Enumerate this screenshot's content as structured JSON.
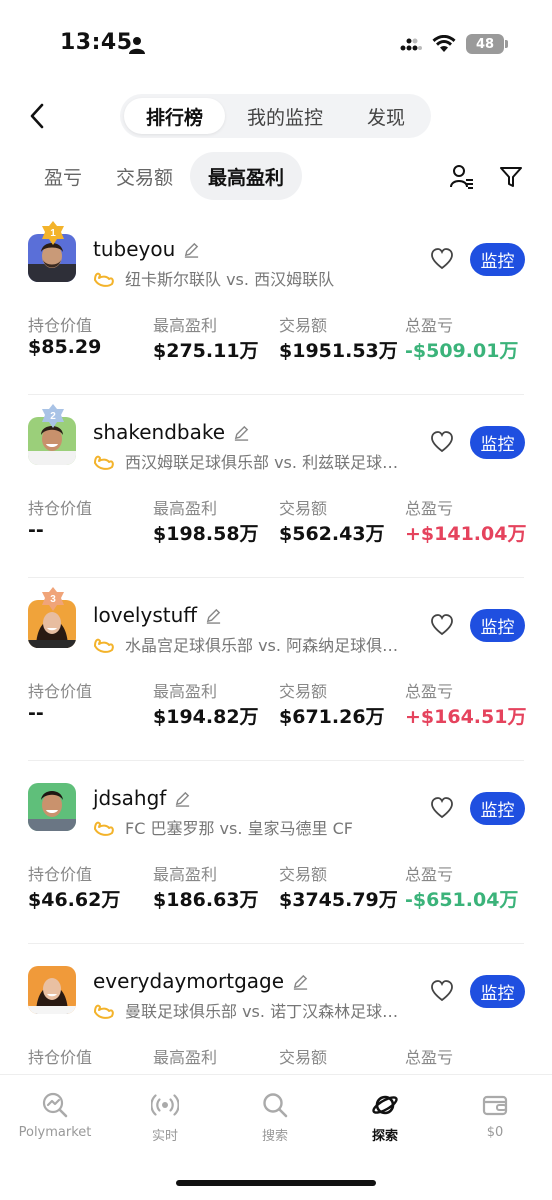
{
  "status_bar": {
    "time": "13:45",
    "battery": "48"
  },
  "nav": {
    "tabs": [
      {
        "label": "排行榜",
        "active": true
      },
      {
        "label": "我的监控",
        "active": false
      },
      {
        "label": "发现",
        "active": false
      }
    ]
  },
  "sub_tabs": [
    {
      "label": "盈亏",
      "active": false
    },
    {
      "label": "交易额",
      "active": false
    },
    {
      "label": "最高盈利",
      "active": true
    }
  ],
  "stat_labels": {
    "position": "持仓价值",
    "max_profit": "最高盈利",
    "volume": "交易额",
    "pnl": "总盈亏"
  },
  "monitor_label": "监控",
  "rank_badges": [
    "1",
    "2",
    "3"
  ],
  "colors": {
    "accent": "#1f4fe0",
    "profit": "#e5435d",
    "loss": "#3bb37a",
    "gold": "#f3b32b",
    "silver": "#a9c3e6",
    "bronze": "#f0a479"
  },
  "traders": [
    {
      "rank": "1",
      "name": "tubeyou",
      "match": "纽卡斯尔联队 vs. 西汉姆联队",
      "position": "$85.29",
      "max_profit": "$275.11万",
      "volume": "$1951.53万",
      "pnl": "-$509.01万",
      "pnl_sign": "neg"
    },
    {
      "rank": "2",
      "name": "shakendbake",
      "match": "西汉姆联足球俱乐部 vs. 利兹联足球俱乐部",
      "position": "--",
      "max_profit": "$198.58万",
      "volume": "$562.43万",
      "pnl": "+$141.04万",
      "pnl_sign": "pos"
    },
    {
      "rank": "3",
      "name": "lovelystuff",
      "match": "水晶宫足球俱乐部 vs. 阿森纳足球俱乐部",
      "position": "--",
      "max_profit": "$194.82万",
      "volume": "$671.26万",
      "pnl": "+$164.51万",
      "pnl_sign": "pos"
    },
    {
      "rank": "",
      "name": "jdsahgf",
      "match": "FC 巴塞罗那 vs. 皇家马德里 CF",
      "position": "$46.62万",
      "max_profit": "$186.63万",
      "volume": "$3745.79万",
      "pnl": "-$651.04万",
      "pnl_sign": "neg"
    },
    {
      "rank": "",
      "name": "everydaymortgage",
      "match": "曼联足球俱乐部 vs. 诺丁汉森林足球俱乐部",
      "position": "",
      "max_profit": "",
      "volume": "",
      "pnl": "",
      "pnl_sign": "neg"
    }
  ],
  "bottom_tabs": [
    {
      "label": "Polymarket",
      "icon": "polymarket-icon",
      "active": false
    },
    {
      "label": "实时",
      "icon": "live-icon",
      "active": false
    },
    {
      "label": "搜索",
      "icon": "search-icon",
      "active": false
    },
    {
      "label": "探索",
      "icon": "explore-icon",
      "active": true
    },
    {
      "label": "$0",
      "icon": "wallet-icon",
      "active": false
    }
  ]
}
